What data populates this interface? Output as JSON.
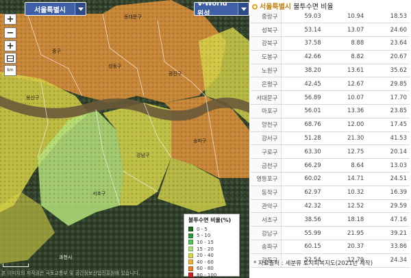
{
  "map": {
    "region_select": "서울특별시",
    "layer_select": "V-World 위성",
    "controls": {
      "zoom_in": "+",
      "zoom_out": "−",
      "full_extent": "+",
      "ruler": "km"
    },
    "districts": [
      {
        "name": "동대문구"
      },
      {
        "name": "중구"
      },
      {
        "name": "성동구"
      },
      {
        "name": "광진구"
      },
      {
        "name": "용산구"
      },
      {
        "name": "송파구"
      },
      {
        "name": "강남구"
      },
      {
        "name": "서초구"
      },
      {
        "name": "과천시"
      }
    ],
    "copyright": "본 이미지의 저작권은 국토교통부 및 공간정보산업진흥원에 있습니다.",
    "legend": {
      "title": "불투수면 비율(%)",
      "items": [
        {
          "label": "0 - 5",
          "color": "#1f6e1f"
        },
        {
          "label": "5 - 10",
          "color": "#2e9a3a"
        },
        {
          "label": "10 - 15",
          "color": "#52c452"
        },
        {
          "label": "15 - 20",
          "color": "#a6e07a"
        },
        {
          "label": "20 - 40",
          "color": "#d6d64a"
        },
        {
          "label": "40 - 60",
          "color": "#f0b43c"
        },
        {
          "label": "60 - 80",
          "color": "#e67e2a"
        },
        {
          "label": "80 - 100",
          "color": "#d42020"
        }
      ]
    }
  },
  "table": {
    "region": "서울특별시",
    "title": "불투수면 비율",
    "rows": [
      {
        "name": "중랑구",
        "v1": "59.03",
        "v2": "10.94",
        "v3": "18.53"
      },
      {
        "name": "성북구",
        "v1": "53.14",
        "v2": "13.07",
        "v3": "24.60"
      },
      {
        "name": "강북구",
        "v1": "37.58",
        "v2": "8.88",
        "v3": "23.64"
      },
      {
        "name": "도봉구",
        "v1": "42.66",
        "v2": "8.82",
        "v3": "20.67"
      },
      {
        "name": "노원구",
        "v1": "38.20",
        "v2": "13.61",
        "v3": "35.62"
      },
      {
        "name": "은평구",
        "v1": "42.45",
        "v2": "12.67",
        "v3": "29.85"
      },
      {
        "name": "서대문구",
        "v1": "56.89",
        "v2": "10.07",
        "v3": "17.70"
      },
      {
        "name": "마포구",
        "v1": "56.01",
        "v2": "13.36",
        "v3": "23.85"
      },
      {
        "name": "양천구",
        "v1": "68.76",
        "v2": "12.00",
        "v3": "17.45"
      },
      {
        "name": "강서구",
        "v1": "51.28",
        "v2": "21.30",
        "v3": "41.53"
      },
      {
        "name": "구로구",
        "v1": "63.30",
        "v2": "12.75",
        "v3": "20.14"
      },
      {
        "name": "금천구",
        "v1": "66.29",
        "v2": "8.64",
        "v3": "13.03"
      },
      {
        "name": "영등포구",
        "v1": "60.02",
        "v2": "14.71",
        "v3": "24.51"
      },
      {
        "name": "동작구",
        "v1": "62.97",
        "v2": "10.32",
        "v3": "16.39"
      },
      {
        "name": "관악구",
        "v1": "42.32",
        "v2": "12.52",
        "v3": "29.59"
      },
      {
        "name": "서초구",
        "v1": "38.56",
        "v2": "18.18",
        "v3": "47.16"
      },
      {
        "name": "강남구",
        "v1": "55.99",
        "v2": "21.95",
        "v3": "39.21"
      },
      {
        "name": "송파구",
        "v1": "60.15",
        "v2": "20.37",
        "v3": "33.86"
      },
      {
        "name": "강동구",
        "v1": "52.54",
        "v2": "12.79",
        "v3": "24.34"
      }
    ],
    "source": "* 자료출처 : 세분류 토지피복지도(2021년 제작)"
  }
}
